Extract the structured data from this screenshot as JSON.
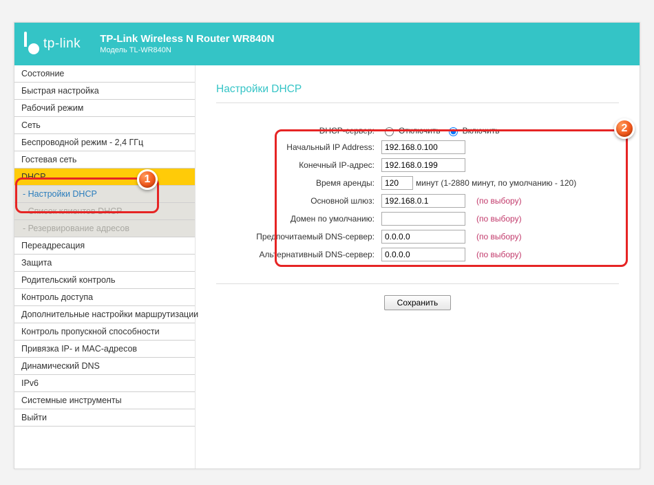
{
  "header": {
    "brand": "tp-link",
    "title": "TP-Link Wireless N Router WR840N",
    "subtitle": "Модель TL-WR840N"
  },
  "sidebar": {
    "items": [
      {
        "label": "Состояние",
        "type": "item"
      },
      {
        "label": "Быстрая настройка",
        "type": "item"
      },
      {
        "label": "Рабочий режим",
        "type": "item"
      },
      {
        "label": "Сеть",
        "type": "item"
      },
      {
        "label": "Беспроводной режим - 2,4 ГГц",
        "type": "item"
      },
      {
        "label": "Гостевая сеть",
        "type": "item"
      },
      {
        "label": "DHCP",
        "type": "item-active"
      },
      {
        "label": " - Настройки DHCP",
        "type": "sub"
      },
      {
        "label": " - Список клиентов DHCP",
        "type": "sub-disabled"
      },
      {
        "label": " - Резервирование адресов",
        "type": "sub-disabled"
      },
      {
        "label": "Переадресация",
        "type": "item"
      },
      {
        "label": "Защита",
        "type": "item"
      },
      {
        "label": "Родительский контроль",
        "type": "item"
      },
      {
        "label": "Контроль доступа",
        "type": "item"
      },
      {
        "label": "Дополнительные настройки маршрутизации",
        "type": "item"
      },
      {
        "label": "Контроль пропускной способности",
        "type": "item"
      },
      {
        "label": "Привязка IP- и MAC-адресов",
        "type": "item"
      },
      {
        "label": "Динамический DNS",
        "type": "item"
      },
      {
        "label": "IPv6",
        "type": "item"
      },
      {
        "label": "Системные инструменты",
        "type": "item"
      },
      {
        "label": "Выйти",
        "type": "item"
      }
    ]
  },
  "content": {
    "page_title": "Настройки DHCP",
    "labels": {
      "dhcp_server": "DHCP-сервер:",
      "disable": "Отключить",
      "enable": "Включить",
      "start_ip": "Начальный IP Address:",
      "end_ip": "Конечный IP-адрес:",
      "lease": "Время аренды:",
      "lease_hint": "минут (1-2880 минут, по умолчанию - 120)",
      "gateway": "Основной шлюз:",
      "default_domain": "Домен по умолчанию:",
      "pref_dns": "Предпочитаемый DNS-сервер:",
      "alt_dns": "Альтернативный DNS-сервер:",
      "optional": "(по выбору)"
    },
    "values": {
      "start_ip": "192.168.0.100",
      "end_ip": "192.168.0.199",
      "lease": "120",
      "gateway": "192.168.0.1",
      "default_domain": "",
      "pref_dns": "0.0.0.0",
      "alt_dns": "0.0.0.0"
    },
    "save": "Сохранить"
  },
  "markers": {
    "m1": "1",
    "m2": "2"
  }
}
